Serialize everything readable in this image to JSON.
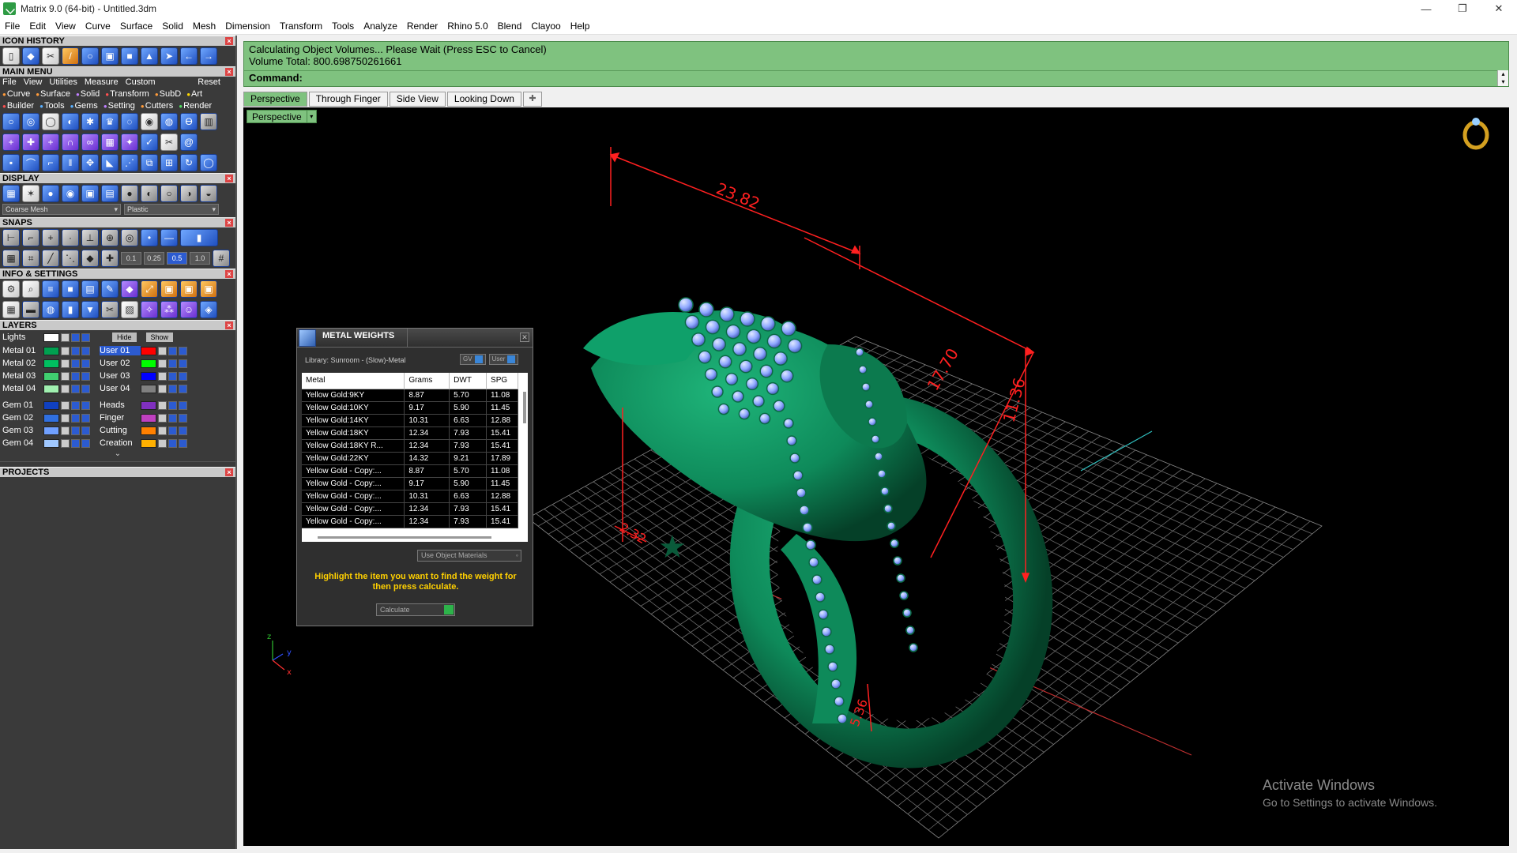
{
  "window": {
    "title": "Matrix 9.0 (64-bit) - Untitled.3dm",
    "minimize": "—",
    "restore": "❐",
    "close": "✕"
  },
  "menubar": [
    "File",
    "Edit",
    "View",
    "Curve",
    "Surface",
    "Solid",
    "Mesh",
    "Dimension",
    "Transform",
    "Tools",
    "Analyze",
    "Render",
    "Rhino 5.0",
    "Blend",
    "Clayoo",
    "Help"
  ],
  "left_panel": {
    "icon_history": "ICON HISTORY",
    "main_menu": "MAIN MENU",
    "main_menu_items": [
      "File",
      "View",
      "Utilities",
      "Measure",
      "Custom"
    ],
    "reset": "Reset",
    "categories_row1": [
      "Curve",
      "Surface",
      "Solid",
      "Transform",
      "SubD",
      "Art"
    ],
    "categories_row2": [
      "Builder",
      "Tools",
      "Gems",
      "Setting",
      "Cutters",
      "Render"
    ],
    "display": "DISPLAY",
    "display_mesh": "Coarse Mesh",
    "display_material": "Plastic",
    "snaps": "SNAPS",
    "snap_values": [
      "0.1",
      "0.25",
      "0.5",
      "1.0"
    ],
    "info_settings": "INFO & SETTINGS",
    "layers": "LAYERS",
    "lights": "Lights",
    "hide": "Hide",
    "show": "Show",
    "projects": "PROJECTS",
    "layer_rows": [
      {
        "left": "Metal 01",
        "left_color": "#00a050",
        "right": "User 01",
        "right_color": "#ff0000"
      },
      {
        "left": "Metal 02",
        "left_color": "#00c060",
        "right": "User 02",
        "right_color": "#00ff00"
      },
      {
        "left": "Metal 03",
        "left_color": "#40d070",
        "right": "User 03",
        "right_color": "#0000ff"
      },
      {
        "left": "Metal 04",
        "left_color": "#a0f0b0",
        "right": "User 04",
        "right_color": "#808080"
      }
    ],
    "gem_rows": [
      {
        "left": "Gem 01",
        "left_color": "#1040c0",
        "right": "Heads",
        "right_color": "#8030c0"
      },
      {
        "left": "Gem 02",
        "left_color": "#3070e0",
        "right": "Finger",
        "right_color": "#c040c0"
      },
      {
        "left": "Gem 03",
        "left_color": "#70a0ff",
        "right": "Cutting",
        "right_color": "#ff8000"
      },
      {
        "left": "Gem 04",
        "left_color": "#a0c8ff",
        "right": "Creation",
        "right_color": "#ffb000"
      }
    ]
  },
  "command": {
    "line1": "Calculating Object Volumes... Please Wait (Press ESC to Cancel)",
    "line2": "Volume Total: 800.698750261661",
    "prompt": "Command:"
  },
  "view_tabs": [
    "Perspective",
    "Through Finger",
    "Side View",
    "Looking Down"
  ],
  "viewport": {
    "label": "Perspective",
    "dimensions": [
      "23.82",
      "17.70",
      "11.36",
      "2.32",
      "5.36"
    ],
    "axis_z": "z",
    "axis_y": "y",
    "axis_x": "x"
  },
  "activate_windows": {
    "title": "Activate Windows",
    "subtitle": "Go to Settings to activate Windows."
  },
  "metal_weights": {
    "title": "METAL WEIGHTS",
    "library": "Library: Sunroom - (Slow)-Metal",
    "gv": "GV",
    "user": "User",
    "columns": [
      "Metal",
      "Grams",
      "DWT",
      "SPG"
    ],
    "rows": [
      [
        "Yellow Gold:9KY",
        "8.87",
        "5.70",
        "11.08"
      ],
      [
        "Yellow Gold:10KY",
        "9.17",
        "5.90",
        "11.45"
      ],
      [
        "Yellow Gold:14KY",
        "10.31",
        "6.63",
        "12.88"
      ],
      [
        "Yellow Gold:18KY",
        "12.34",
        "7.93",
        "15.41"
      ],
      [
        "Yellow Gold:18KY R...",
        "12.34",
        "7.93",
        "15.41"
      ],
      [
        "Yellow Gold:22KY",
        "14.32",
        "9.21",
        "17.89"
      ],
      [
        "Yellow Gold - Copy:...",
        "8.87",
        "5.70",
        "11.08"
      ],
      [
        "Yellow Gold - Copy:...",
        "9.17",
        "5.90",
        "11.45"
      ],
      [
        "Yellow Gold - Copy:...",
        "10.31",
        "6.63",
        "12.88"
      ],
      [
        "Yellow Gold - Copy:...",
        "12.34",
        "7.93",
        "15.41"
      ],
      [
        "Yellow Gold - Copy:...",
        "12.34",
        "7.93",
        "15.41"
      ]
    ],
    "use_materials": "Use Object Materials",
    "help_text": "Highlight the item you want to find the weight for then press calculate.",
    "calculate": "Calculate"
  },
  "colors": {
    "ring": "#0e8a5a",
    "ring_dark": "#064a30",
    "gem": "#8fa8ff",
    "dimension": "#ff2020",
    "grid": "#777777",
    "command_bg": "#7fc27f"
  }
}
